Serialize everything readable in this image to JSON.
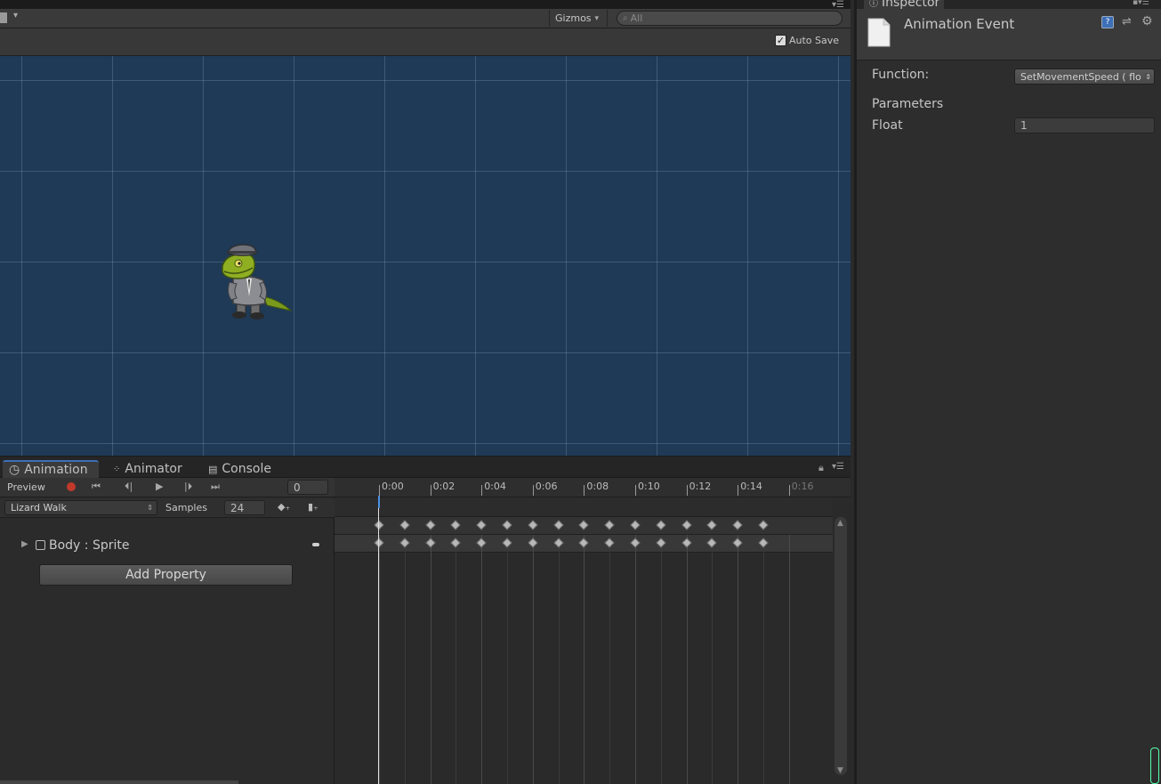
{
  "scene": {
    "gizmos_label": "Gizmos",
    "search_placeholder": "All",
    "auto_save_label": "Auto Save",
    "auto_save_checked": true,
    "background_color": "#1f3a56"
  },
  "inspector": {
    "tab_label": "Inspector",
    "title": "Animation Event",
    "function_label": "Function:",
    "function_value": "SetMovementSpeed ( flo",
    "parameters_label": "Parameters",
    "float_label": "Float",
    "float_value": "1"
  },
  "animation_window": {
    "tabs": [
      {
        "label": "Animation",
        "icon": "clock-icon",
        "active": true
      },
      {
        "label": "Animator",
        "icon": "animator-icon",
        "active": false
      },
      {
        "label": "Console",
        "icon": "console-icon",
        "active": false
      }
    ],
    "preview_label": "Preview",
    "frame_value": "0",
    "clip_name": "Lizard Walk",
    "samples_label": "Samples",
    "samples_value": "24",
    "property_name": "Body : Sprite",
    "add_property_label": "Add Property",
    "time_ticks": [
      "0:00",
      "0:02",
      "0:04",
      "0:06",
      "0:08",
      "0:10",
      "0:12",
      "0:14",
      "0:16"
    ],
    "keyframe_count": 16,
    "record_color": "#c0392b"
  }
}
